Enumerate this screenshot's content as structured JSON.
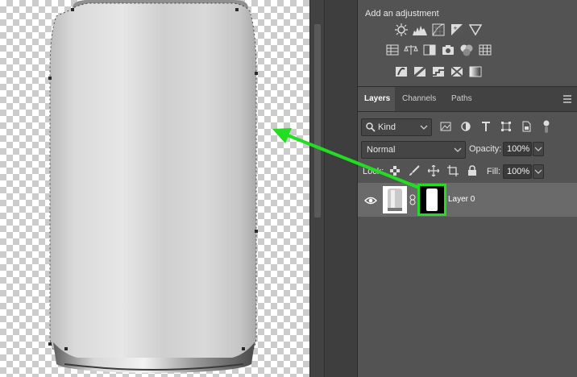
{
  "adjustments": {
    "title": "Add an adjustment",
    "row1": [
      "brightness-contrast-icon",
      "levels-icon",
      "curves-icon",
      "exposure-icon",
      "vibrance-icon"
    ],
    "row2": [
      "hue-saturation-icon",
      "color-balance-icon",
      "black-white-icon",
      "photo-filter-icon",
      "channel-mixer-icon",
      "color-lookup-icon"
    ],
    "row3": [
      "invert-icon",
      "posterize-icon",
      "threshold-icon",
      "selective-color-icon",
      "gradient-map-icon"
    ]
  },
  "tabs": [
    "Layers",
    "Channels",
    "Paths"
  ],
  "filter": {
    "kind_label": "Kind"
  },
  "blend": {
    "mode": "Normal",
    "opacity_label": "Opacity:",
    "opacity_value": "100%"
  },
  "lock": {
    "label": "Lock:",
    "fill_label": "Fill:",
    "fill_value": "100%"
  },
  "layer": {
    "name": "Layer 0"
  },
  "colors": {
    "highlight": "#22dd22",
    "panel_bg": "#535353"
  }
}
